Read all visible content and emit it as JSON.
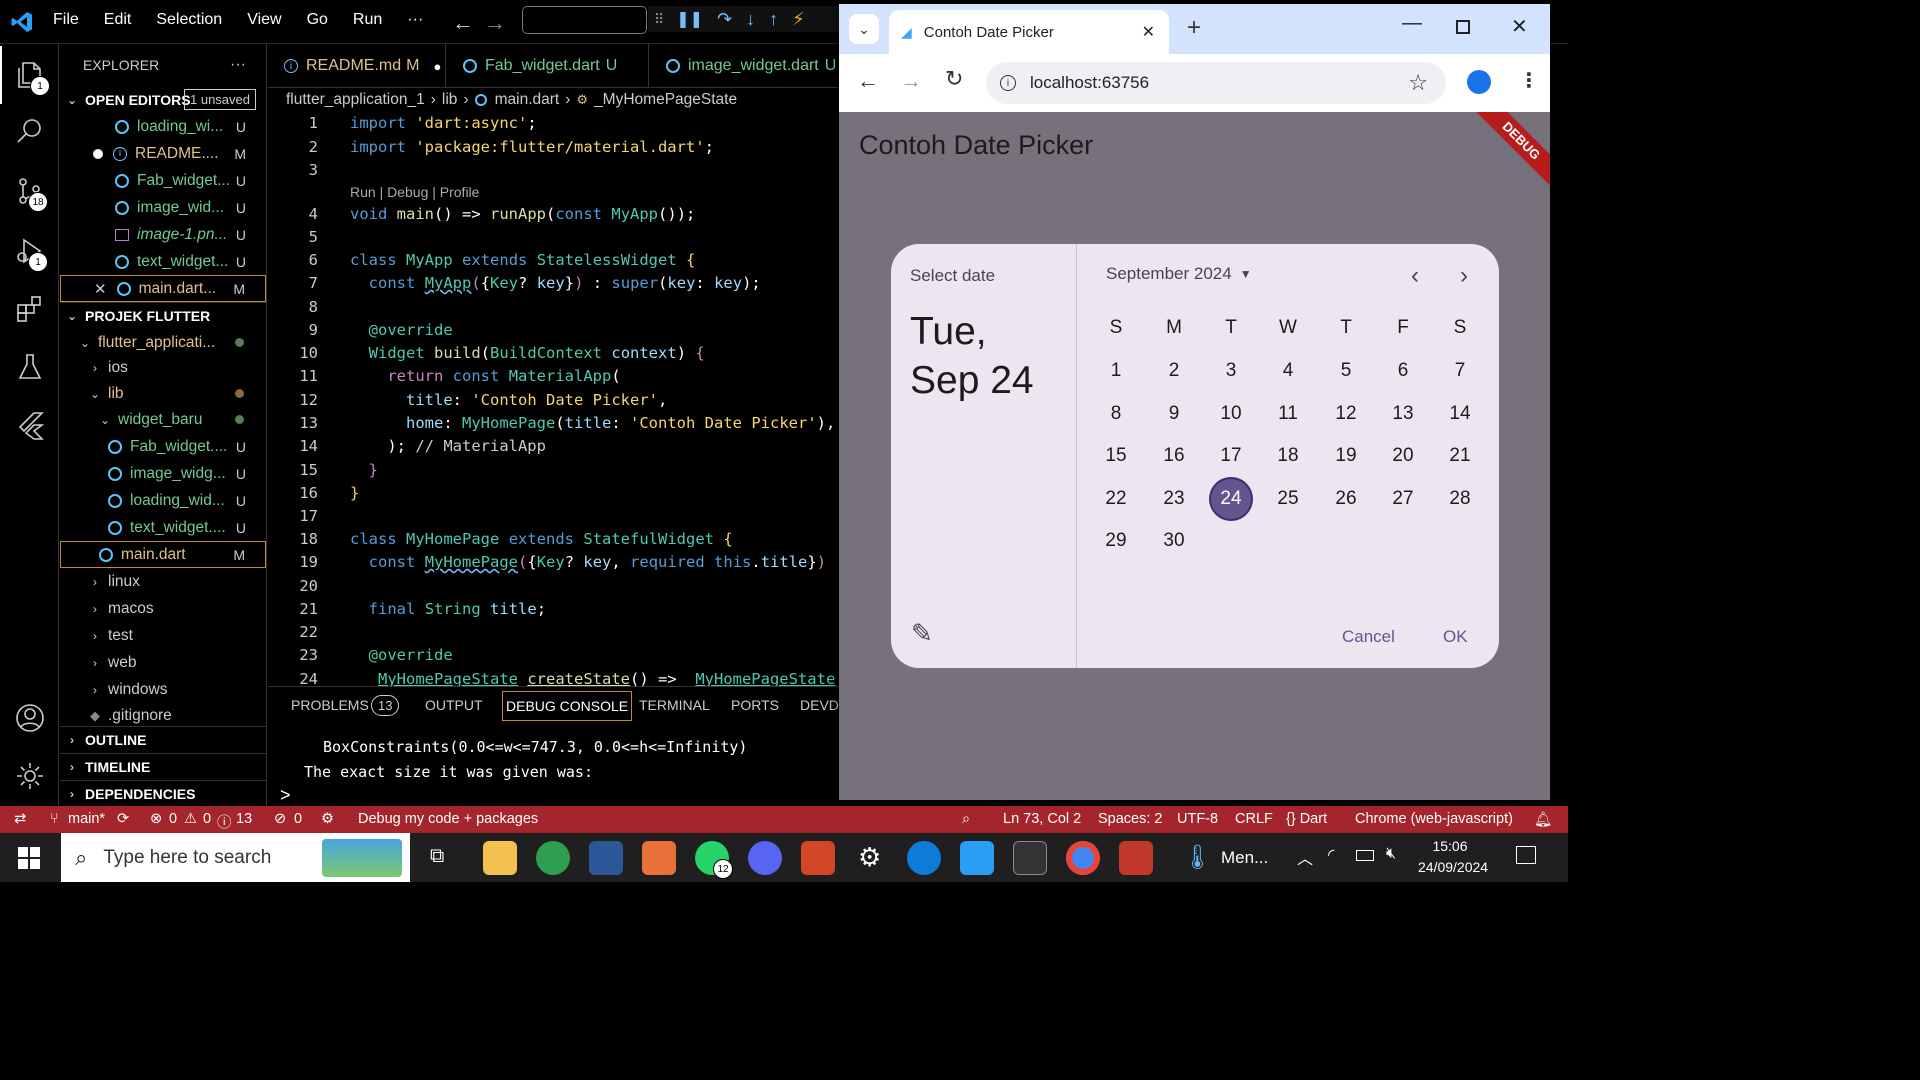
{
  "vscode": {
    "menu": [
      "File",
      "Edit",
      "Selection",
      "View",
      "Go",
      "Run",
      "···"
    ],
    "activity_badges": {
      "explorer": "1",
      "scm": "18",
      "debug": "1"
    },
    "sidebar": {
      "title": "EXPLORER",
      "more": "···",
      "open_editors": {
        "label": "OPEN EDITORS",
        "unsaved": "1 unsaved",
        "items": [
          {
            "name": "loading_wi...",
            "status": "U"
          },
          {
            "name": "README....",
            "status": "M"
          },
          {
            "name": "Fab_widget...",
            "status": "U"
          },
          {
            "name": "image_wid...",
            "status": "U"
          },
          {
            "name": "image-1.pn...",
            "status": "U"
          },
          {
            "name": "text_widget...",
            "status": "U"
          },
          {
            "name": "main.dart...",
            "status": "M"
          }
        ]
      },
      "project": {
        "label": "PROJEK FLUTTER",
        "root": "flutter_applicati...",
        "folders_top": [
          "ios"
        ],
        "lib": "lib",
        "widget_baru": "widget_baru",
        "widget_files": [
          {
            "name": "Fab_widget....",
            "status": "U"
          },
          {
            "name": "image_widg...",
            "status": "U"
          },
          {
            "name": "loading_wid...",
            "status": "U"
          },
          {
            "name": "text_widget....",
            "status": "U"
          }
        ],
        "main": {
          "name": "main.dart",
          "status": "M"
        },
        "folders_bottom": [
          "linux",
          "macos",
          "test",
          "web",
          "windows"
        ],
        "gitignore": ".gitignore"
      },
      "outline": "OUTLINE",
      "timeline": "TIMELINE",
      "dependencies": "DEPENDENCIES"
    },
    "tabs": [
      {
        "name": "README.md",
        "status": "M",
        "dirty": "●"
      },
      {
        "name": "Fab_widget.dart",
        "status": "U"
      },
      {
        "name": "image_widget.dart",
        "status": "U"
      }
    ],
    "breadcrumb": [
      "flutter_application_1",
      "lib",
      "main.dart",
      "_MyHomePageState"
    ],
    "codelens": "Run | Debug | Profile",
    "line_numbers": [
      "1",
      "2",
      "3",
      "4",
      "5",
      "6",
      "7",
      "8",
      "9",
      "10",
      "11",
      "12",
      "13",
      "14",
      "15",
      "16",
      "17",
      "18",
      "19",
      "20",
      "21",
      "22",
      "23",
      "24"
    ],
    "panel": {
      "tabs": [
        "PROBLEMS",
        "OUTPUT",
        "DEBUG CONSOLE",
        "TERMINAL",
        "PORTS",
        "DEVDE"
      ],
      "problems_count": "13",
      "lines": [
        "BoxConstraints(0.0<=w<=747.3, 0.0<=h<=Infinity)",
        "The exact size it was given was:"
      ],
      "prompt": ">"
    },
    "statusbar": {
      "branch": "main*",
      "errors": "0",
      "warnings": "0",
      "infos": "13",
      "ports": "0",
      "debug": "Debug my code + packages",
      "position": "Ln 73, Col 2",
      "spaces": "Spaces: 2",
      "encoding": "UTF-8",
      "eol": "CRLF",
      "language": "{} Dart",
      "device": "Chrome (web-javascript)"
    }
  },
  "chrome": {
    "tab_title": "Contoh Date Picker",
    "url": "localhost:63756",
    "app_title": "Contoh Date Picker",
    "debug_banner": "DEBUG",
    "date_picker": {
      "header": "Select date",
      "selected_line1": "Tue,",
      "selected_line2": "Sep 24",
      "month": "September 2024",
      "weekdays": [
        "S",
        "M",
        "T",
        "W",
        "T",
        "F",
        "S"
      ],
      "days": [
        "1",
        "2",
        "3",
        "4",
        "5",
        "6",
        "7",
        "8",
        "9",
        "10",
        "11",
        "12",
        "13",
        "14",
        "15",
        "16",
        "17",
        "18",
        "19",
        "20",
        "21",
        "22",
        "23",
        "24",
        "25",
        "26",
        "27",
        "28",
        "29",
        "30"
      ],
      "selected_day": "24",
      "first_weekday_index": 0,
      "cancel": "Cancel",
      "ok": "OK",
      "accent": "#65558f"
    }
  },
  "taskbar": {
    "search_placeholder": "Type here to search",
    "whatsapp_badge": "12",
    "menu_label": "Men...",
    "time": "15:06",
    "date": "24/09/2024"
  }
}
